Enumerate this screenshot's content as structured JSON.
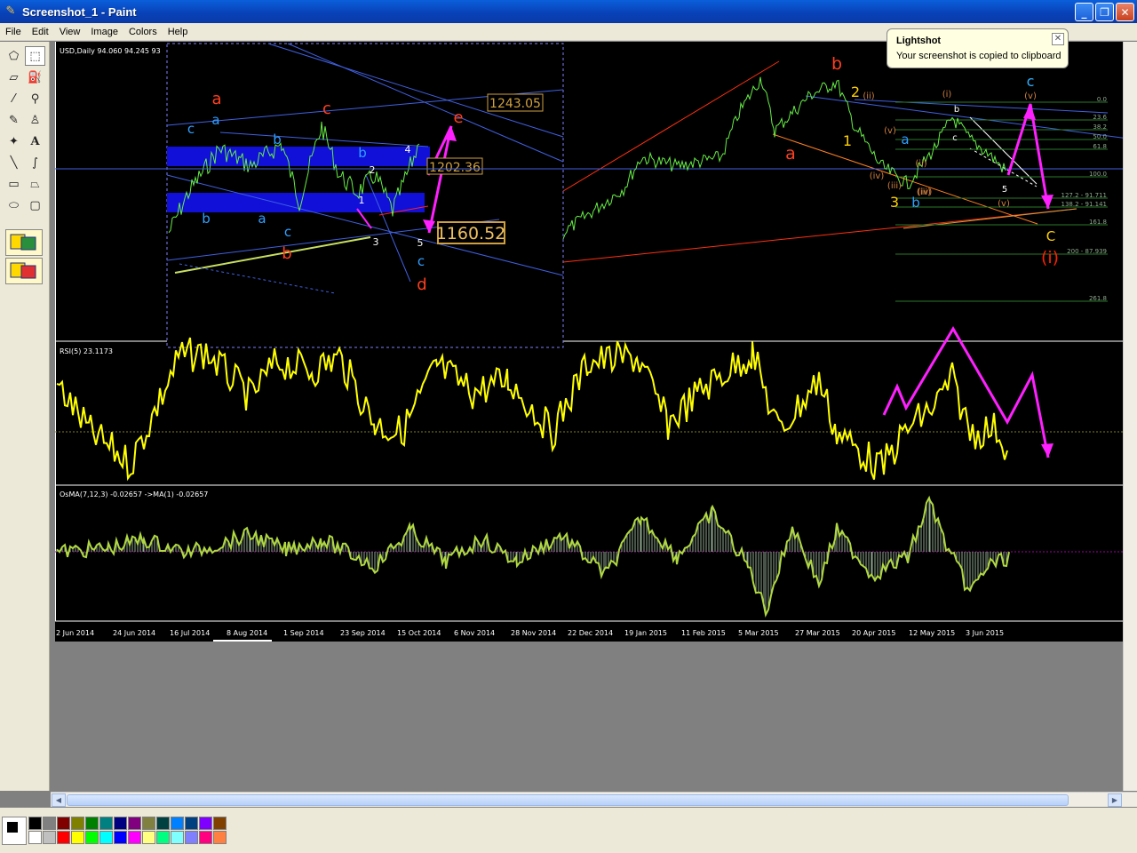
{
  "window": {
    "title": "Screenshot_1 - Paint",
    "min": "_",
    "max": "❐",
    "close": "✕"
  },
  "menu": [
    "File",
    "Edit",
    "View",
    "Image",
    "Colors",
    "Help"
  ],
  "tools": [
    "free-select",
    "rect-select",
    "eraser",
    "fill",
    "color-picker",
    "magnifier",
    "pencil",
    "brush",
    "airbrush",
    "text",
    "line",
    "curve",
    "rectangle",
    "polygon",
    "ellipse",
    "rounded-rect"
  ],
  "tooltip": {
    "title": "Lightshot",
    "message": "Your screenshot is copied to clipboard",
    "close": "✕"
  },
  "chart": {
    "main_header": "USD,Daily  94.060 94.245 93",
    "rsi_header": "RSI(5) 23.1173",
    "osma_header": "OsMA(7,12,3) -0.02657  ->MA(1) -0.02657",
    "x_labels": [
      "2 Jun 2014",
      "24 Jun 2014",
      "16 Jul 2014",
      "8 Aug 2014",
      "1 Sep 2014",
      "23 Sep 2014",
      "15 Oct 2014",
      "6 Nov 2014",
      "28 Nov 2014",
      "22 Dec 2014",
      "19 Jan 2015",
      "11 Feb 2015",
      "5 Mar 2015",
      "27 Mar 2015",
      "20 Apr 2015",
      "12 May 2015",
      "3 Jun 2015"
    ],
    "inset_prices": [
      "1243.05",
      "1202.36",
      "1160.52"
    ],
    "fib_levels": [
      "0.0",
      "23.6",
      "38.2",
      "50.0",
      "61.8",
      "100.0",
      "127.2 - 91.711",
      "138.2 - 91.141",
      "161.8",
      "200 - 87.939",
      "261.8"
    ],
    "wave_labels": [
      "a",
      "c",
      "a",
      "b",
      "b",
      "b",
      "c",
      "2",
      "1",
      "4",
      "3",
      "5",
      "a",
      "b",
      "c",
      "c",
      "d",
      "e",
      "b",
      "a",
      "2",
      "1",
      "3",
      "b",
      "a",
      "b",
      "c",
      "5",
      "C",
      "(i)",
      "(ii)",
      "(iii)",
      "(iv)",
      "(v)",
      "(iii)",
      "(i)",
      "(ii)",
      "(iv)",
      "(v)"
    ]
  },
  "colors": {
    "palette": [
      "#000000",
      "#808080",
      "#800000",
      "#808000",
      "#008000",
      "#008080",
      "#000080",
      "#800080",
      "#808040",
      "#004040",
      "#0080ff",
      "#004080",
      "#8000ff",
      "#804000",
      "#ffffff",
      "#c0c0c0",
      "#ff0000",
      "#ffff00",
      "#00ff00",
      "#00ffff",
      "#0000ff",
      "#ff00ff",
      "#ffff80",
      "#00ff80",
      "#80ffff",
      "#8080ff",
      "#ff0080",
      "#ff8040"
    ]
  }
}
